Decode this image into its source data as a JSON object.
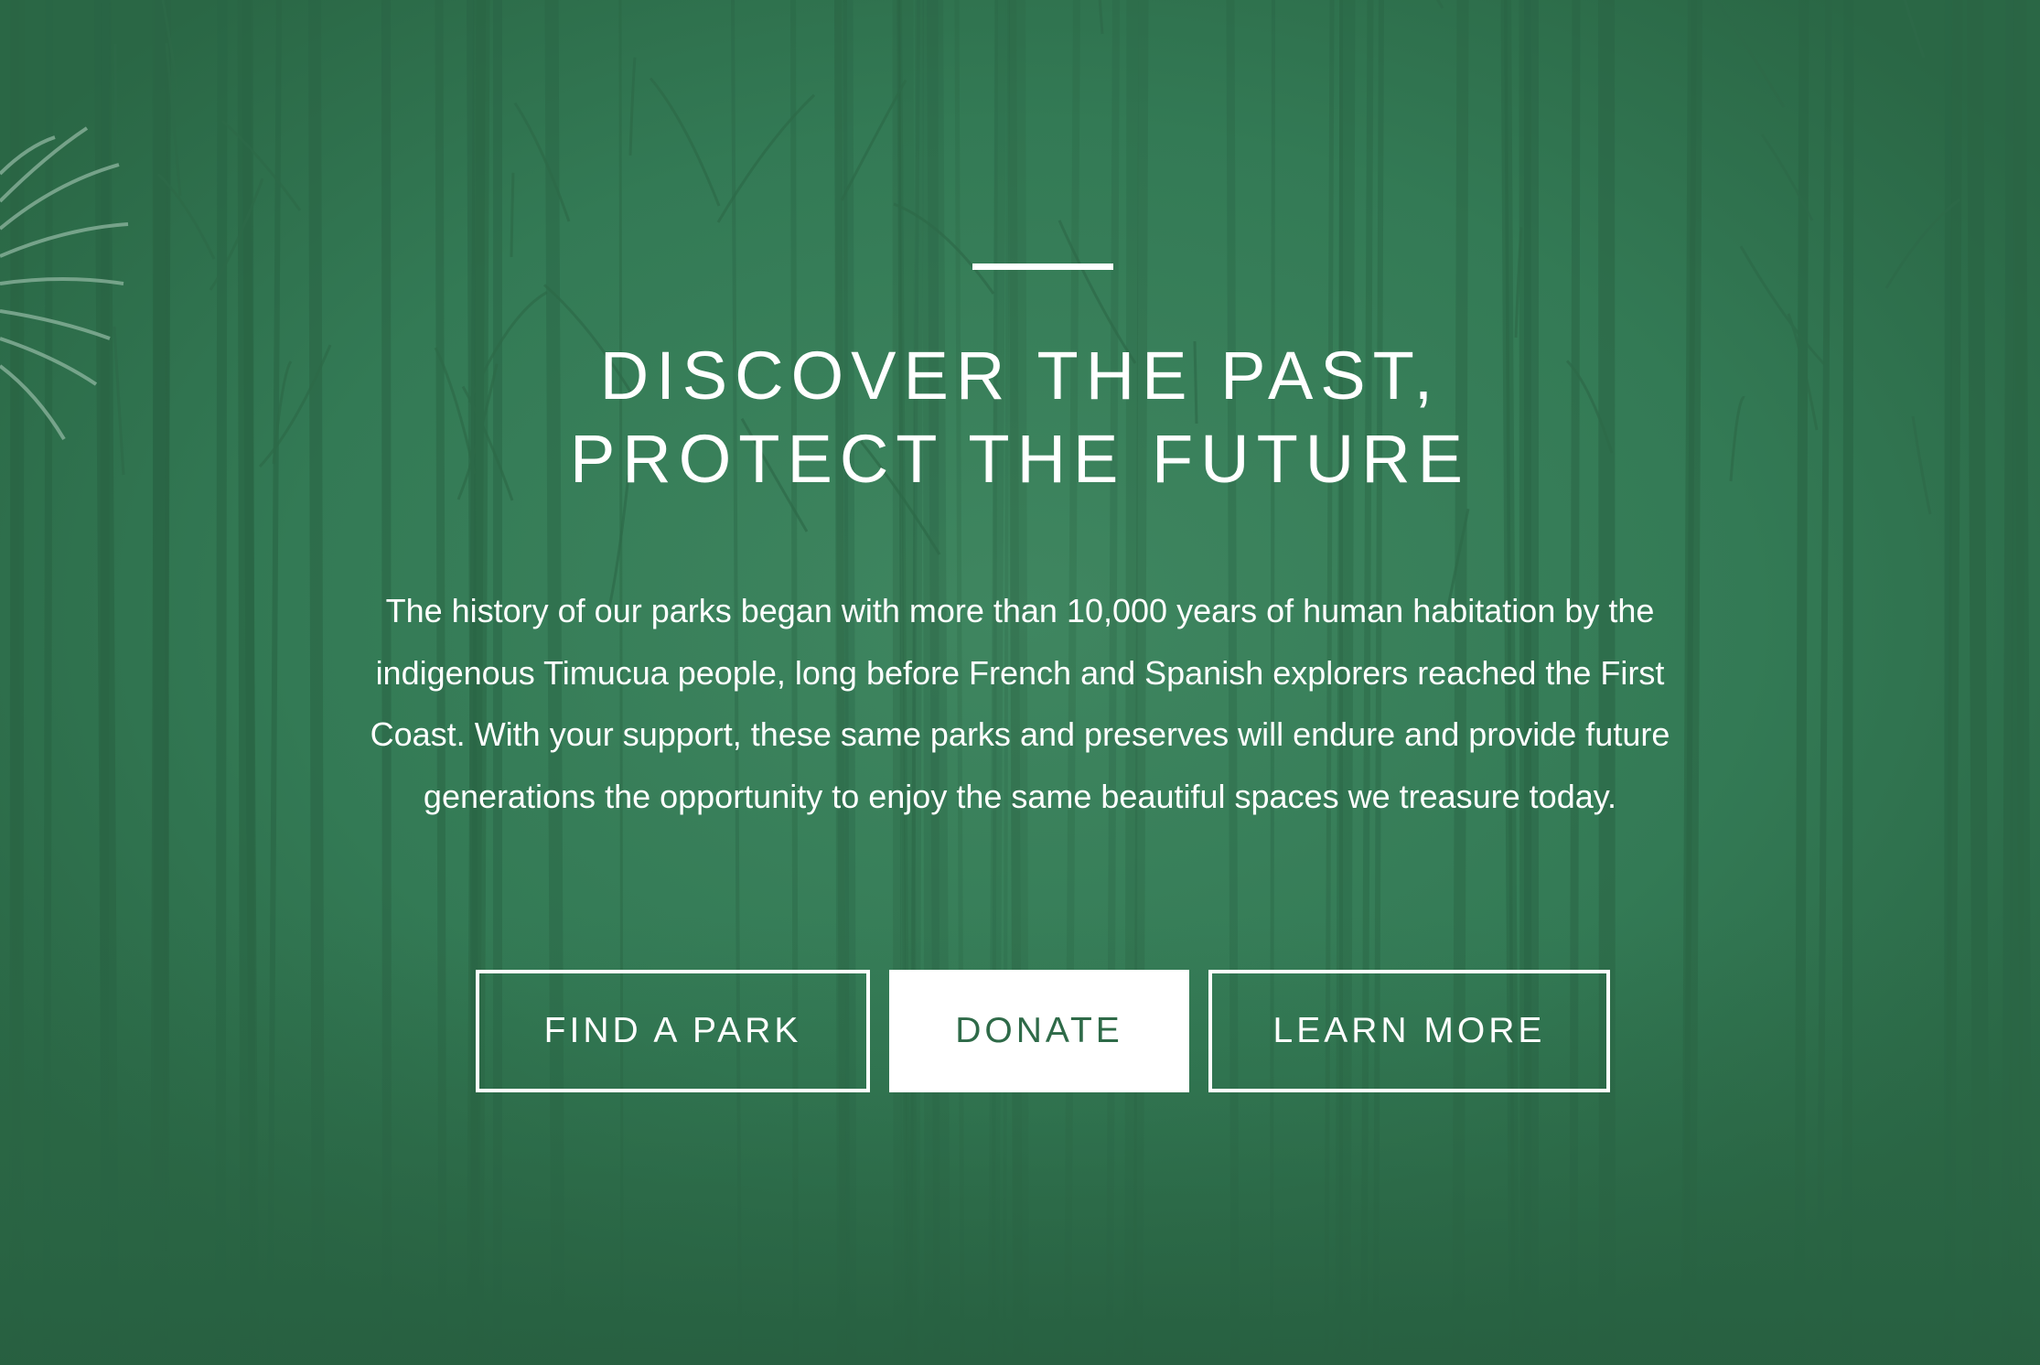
{
  "hero": {
    "headline_line1": "DISCOVER THE PAST,",
    "headline_line2": "PROTECT THE FUTURE",
    "body": "The history of our parks began with more than 10,000 years of human habitation by the indigenous Timucua people, long before French and Spanish explorers reached the First Coast. With your support, these same parks and preserves will endure and provide future generations the opportunity to enjoy the same beautiful spaces we treasure today.",
    "body_lines": [
      "The history of our parks began with more than 10,000 years of human habitation by the",
      "indigenous Timucua people, long before French and Spanish explorers reached the First",
      "Coast. With your support, these same parks and preserves will endure and provide future",
      "generations the opportunity to enjoy the same beautiful spaces we treasure today."
    ]
  },
  "buttons": {
    "find_a_park": "FIND A PARK",
    "donate": "DONATE",
    "learn_more": "LEARN MORE"
  },
  "colors": {
    "overlay_green": "#2f6f4c",
    "text": "#ffffff",
    "donate_text": "#2e6a48"
  },
  "background": {
    "image": "misty-pine-forest-photo",
    "decoration": "palm-frond-icon"
  }
}
